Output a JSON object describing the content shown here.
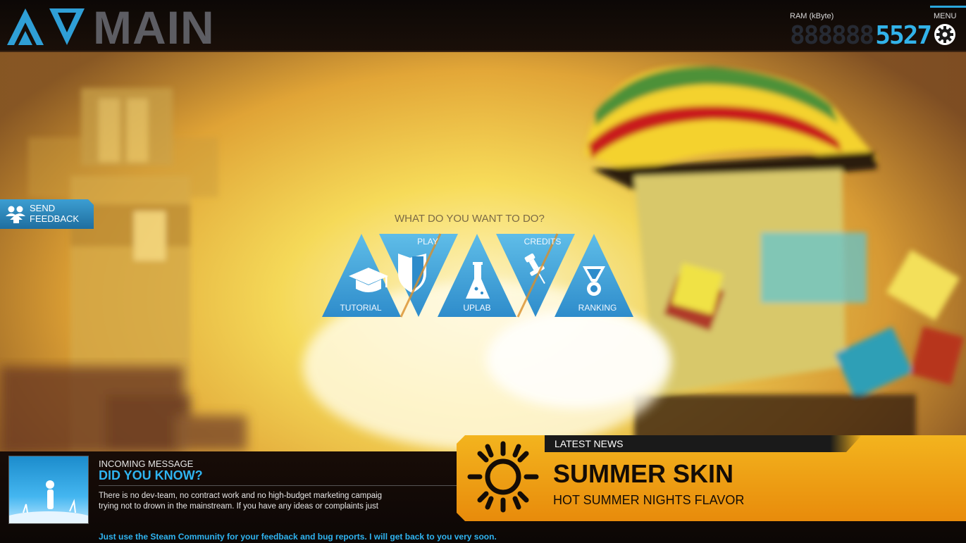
{
  "header": {
    "title": "MAIN",
    "ram_label": "RAM (kByte)",
    "ram_ghost_digits": "888888",
    "ram_value": "5527",
    "menu_label": "MENU"
  },
  "feedback": {
    "label": "SEND\nFEEDBACK"
  },
  "menu": {
    "question": "WHAT DO YOU WANT TO DO?",
    "items": [
      {
        "label": "TUTORIAL",
        "icon": "graduation-cap-icon"
      },
      {
        "label": "PLAY",
        "icon": "shield-icon"
      },
      {
        "label": "UPLAB",
        "icon": "flask-icon"
      },
      {
        "label": "CREDITS",
        "icon": "pushpin-icon"
      },
      {
        "label": "RANKING",
        "icon": "medal-icon"
      }
    ]
  },
  "message": {
    "label": "INCOMING MESSAGE",
    "title": "DID YOU KNOW?",
    "body_line1": "There is no dev-team, no contract work and no high-budget marketing campaig",
    "body_line2": "trying not to drown in the mainstream. If you have any ideas or complaints just",
    "footer": "Just use the Steam Community for your feedback and bug reports. I will get back to you very soon."
  },
  "news": {
    "tag": "LATEST NEWS",
    "title": "SUMMER SKIN",
    "subtitle": "HOT SUMMER NIGHTS FLAVOR",
    "icon": "sun-icon"
  },
  "colors": {
    "accent": "#2fb4f0",
    "news_orange": "#f2a416",
    "menu_blue": "#3fa6dc"
  }
}
